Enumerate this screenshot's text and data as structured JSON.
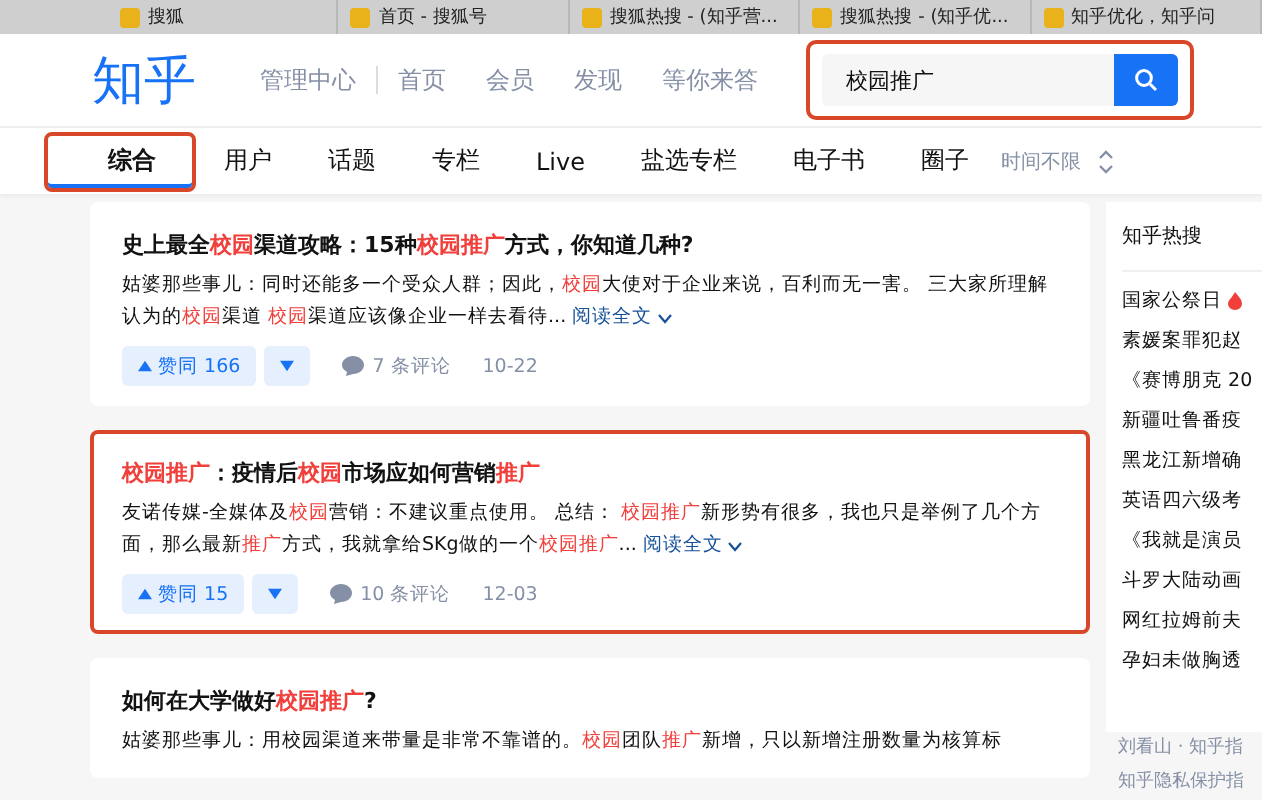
{
  "browser_tabs": [
    {
      "label": "搜狐"
    },
    {
      "label": "首页 - 搜狐号"
    },
    {
      "label": "搜狐热搜 - (知乎营..."
    },
    {
      "label": "搜狐热搜 - (知乎优..."
    },
    {
      "label": "知乎优化，知乎问"
    }
  ],
  "header": {
    "logo": "知乎",
    "nav": [
      {
        "label": "管理中心"
      },
      {
        "label": "首页"
      },
      {
        "label": "会员"
      },
      {
        "label": "发现"
      },
      {
        "label": "等你来答"
      }
    ],
    "search": {
      "value": "校园推广",
      "highlighted": true
    }
  },
  "tabs": [
    {
      "label": "综合",
      "selected": true,
      "highlighted": true
    },
    {
      "label": "用户",
      "selected": false,
      "highlighted": false
    },
    {
      "label": "话题",
      "selected": false,
      "highlighted": false
    },
    {
      "label": "专栏",
      "selected": false,
      "highlighted": false
    },
    {
      "label": "Live",
      "selected": false,
      "highlighted": false
    },
    {
      "label": "盐选专栏",
      "selected": false,
      "highlighted": false
    },
    {
      "label": "电子书",
      "selected": false,
      "highlighted": false
    },
    {
      "label": "圈子",
      "selected": false,
      "highlighted": false
    }
  ],
  "time_filter": "时间不限",
  "results": [
    {
      "highlighted": false,
      "title": [
        {
          "text": "史上最全",
          "hl": false
        },
        {
          "text": "校园",
          "hl": true
        },
        {
          "text": "渠道攻略：15种",
          "hl": false
        },
        {
          "text": "校园推广",
          "hl": true
        },
        {
          "text": "方式，你知道几种?",
          "hl": false
        }
      ],
      "excerpt": [
        {
          "text": "姑婆那些事儿：同时还能多一个受众人群；因此，",
          "hl": false
        },
        {
          "text": "校园",
          "hl": true
        },
        {
          "text": "大使对于企业来说，百利而无一害。 三大家所理解认为的",
          "hl": false
        },
        {
          "text": "校园",
          "hl": true
        },
        {
          "text": "渠道 ",
          "hl": false
        },
        {
          "text": "校园",
          "hl": true
        },
        {
          "text": "渠道应该像企业一样去看待...",
          "hl": false
        }
      ],
      "read_more": "阅读全文",
      "upvote": "赞同 166",
      "comments": "7 条评论",
      "date": "10-22"
    },
    {
      "highlighted": true,
      "title": [
        {
          "text": "校园推广",
          "hl": true
        },
        {
          "text": "：疫情后",
          "hl": false
        },
        {
          "text": "校园",
          "hl": true
        },
        {
          "text": "市场应如何营销",
          "hl": false
        },
        {
          "text": "推广",
          "hl": true
        }
      ],
      "excerpt": [
        {
          "text": "友诺传媒-全媒体及",
          "hl": false
        },
        {
          "text": "校园",
          "hl": true
        },
        {
          "text": "营销：不建议重点使用。 总结： ",
          "hl": false
        },
        {
          "text": "校园推广",
          "hl": true
        },
        {
          "text": "新形势有很多，我也只是举例了几个方面，那么最新",
          "hl": false
        },
        {
          "text": "推广",
          "hl": true
        },
        {
          "text": "方式，我就拿给SKg做的一个",
          "hl": false
        },
        {
          "text": "校园推广",
          "hl": true
        },
        {
          "text": "...",
          "hl": false
        }
      ],
      "read_more": "阅读全文",
      "upvote": "赞同 15",
      "comments": "10 条评论",
      "date": "12-03"
    },
    {
      "highlighted": false,
      "title": [
        {
          "text": "如何在大学做好",
          "hl": false
        },
        {
          "text": "校园推广",
          "hl": true
        },
        {
          "text": "?",
          "hl": false
        }
      ],
      "excerpt": [
        {
          "text": "姑婆那些事儿：用校园渠道来带量是非常不靠谱的。",
          "hl": false
        },
        {
          "text": "校园",
          "hl": true
        },
        {
          "text": "团队",
          "hl": false
        },
        {
          "text": "推广",
          "hl": true
        },
        {
          "text": "新增，只以新增注册数量为核算标",
          "hl": false
        }
      ]
    }
  ],
  "sidebar": {
    "title": "知乎热搜",
    "items": [
      {
        "label": "国家公祭日",
        "hot": true
      },
      {
        "label": "素媛案罪犯赵",
        "hot": false
      },
      {
        "label": "《赛博朋克 20",
        "hot": false
      },
      {
        "label": "新疆吐鲁番疫",
        "hot": false
      },
      {
        "label": "黑龙江新增确",
        "hot": false
      },
      {
        "label": "英语四六级考",
        "hot": false
      },
      {
        "label": "《我就是演员",
        "hot": false
      },
      {
        "label": "斗罗大陆动画",
        "hot": false
      },
      {
        "label": "网红拉姆前夫",
        "hot": false
      },
      {
        "label": "孕妇未做胸透",
        "hot": false
      }
    ],
    "footer": [
      "刘看山 · 知乎指",
      "知乎隐私保护指"
    ]
  }
}
